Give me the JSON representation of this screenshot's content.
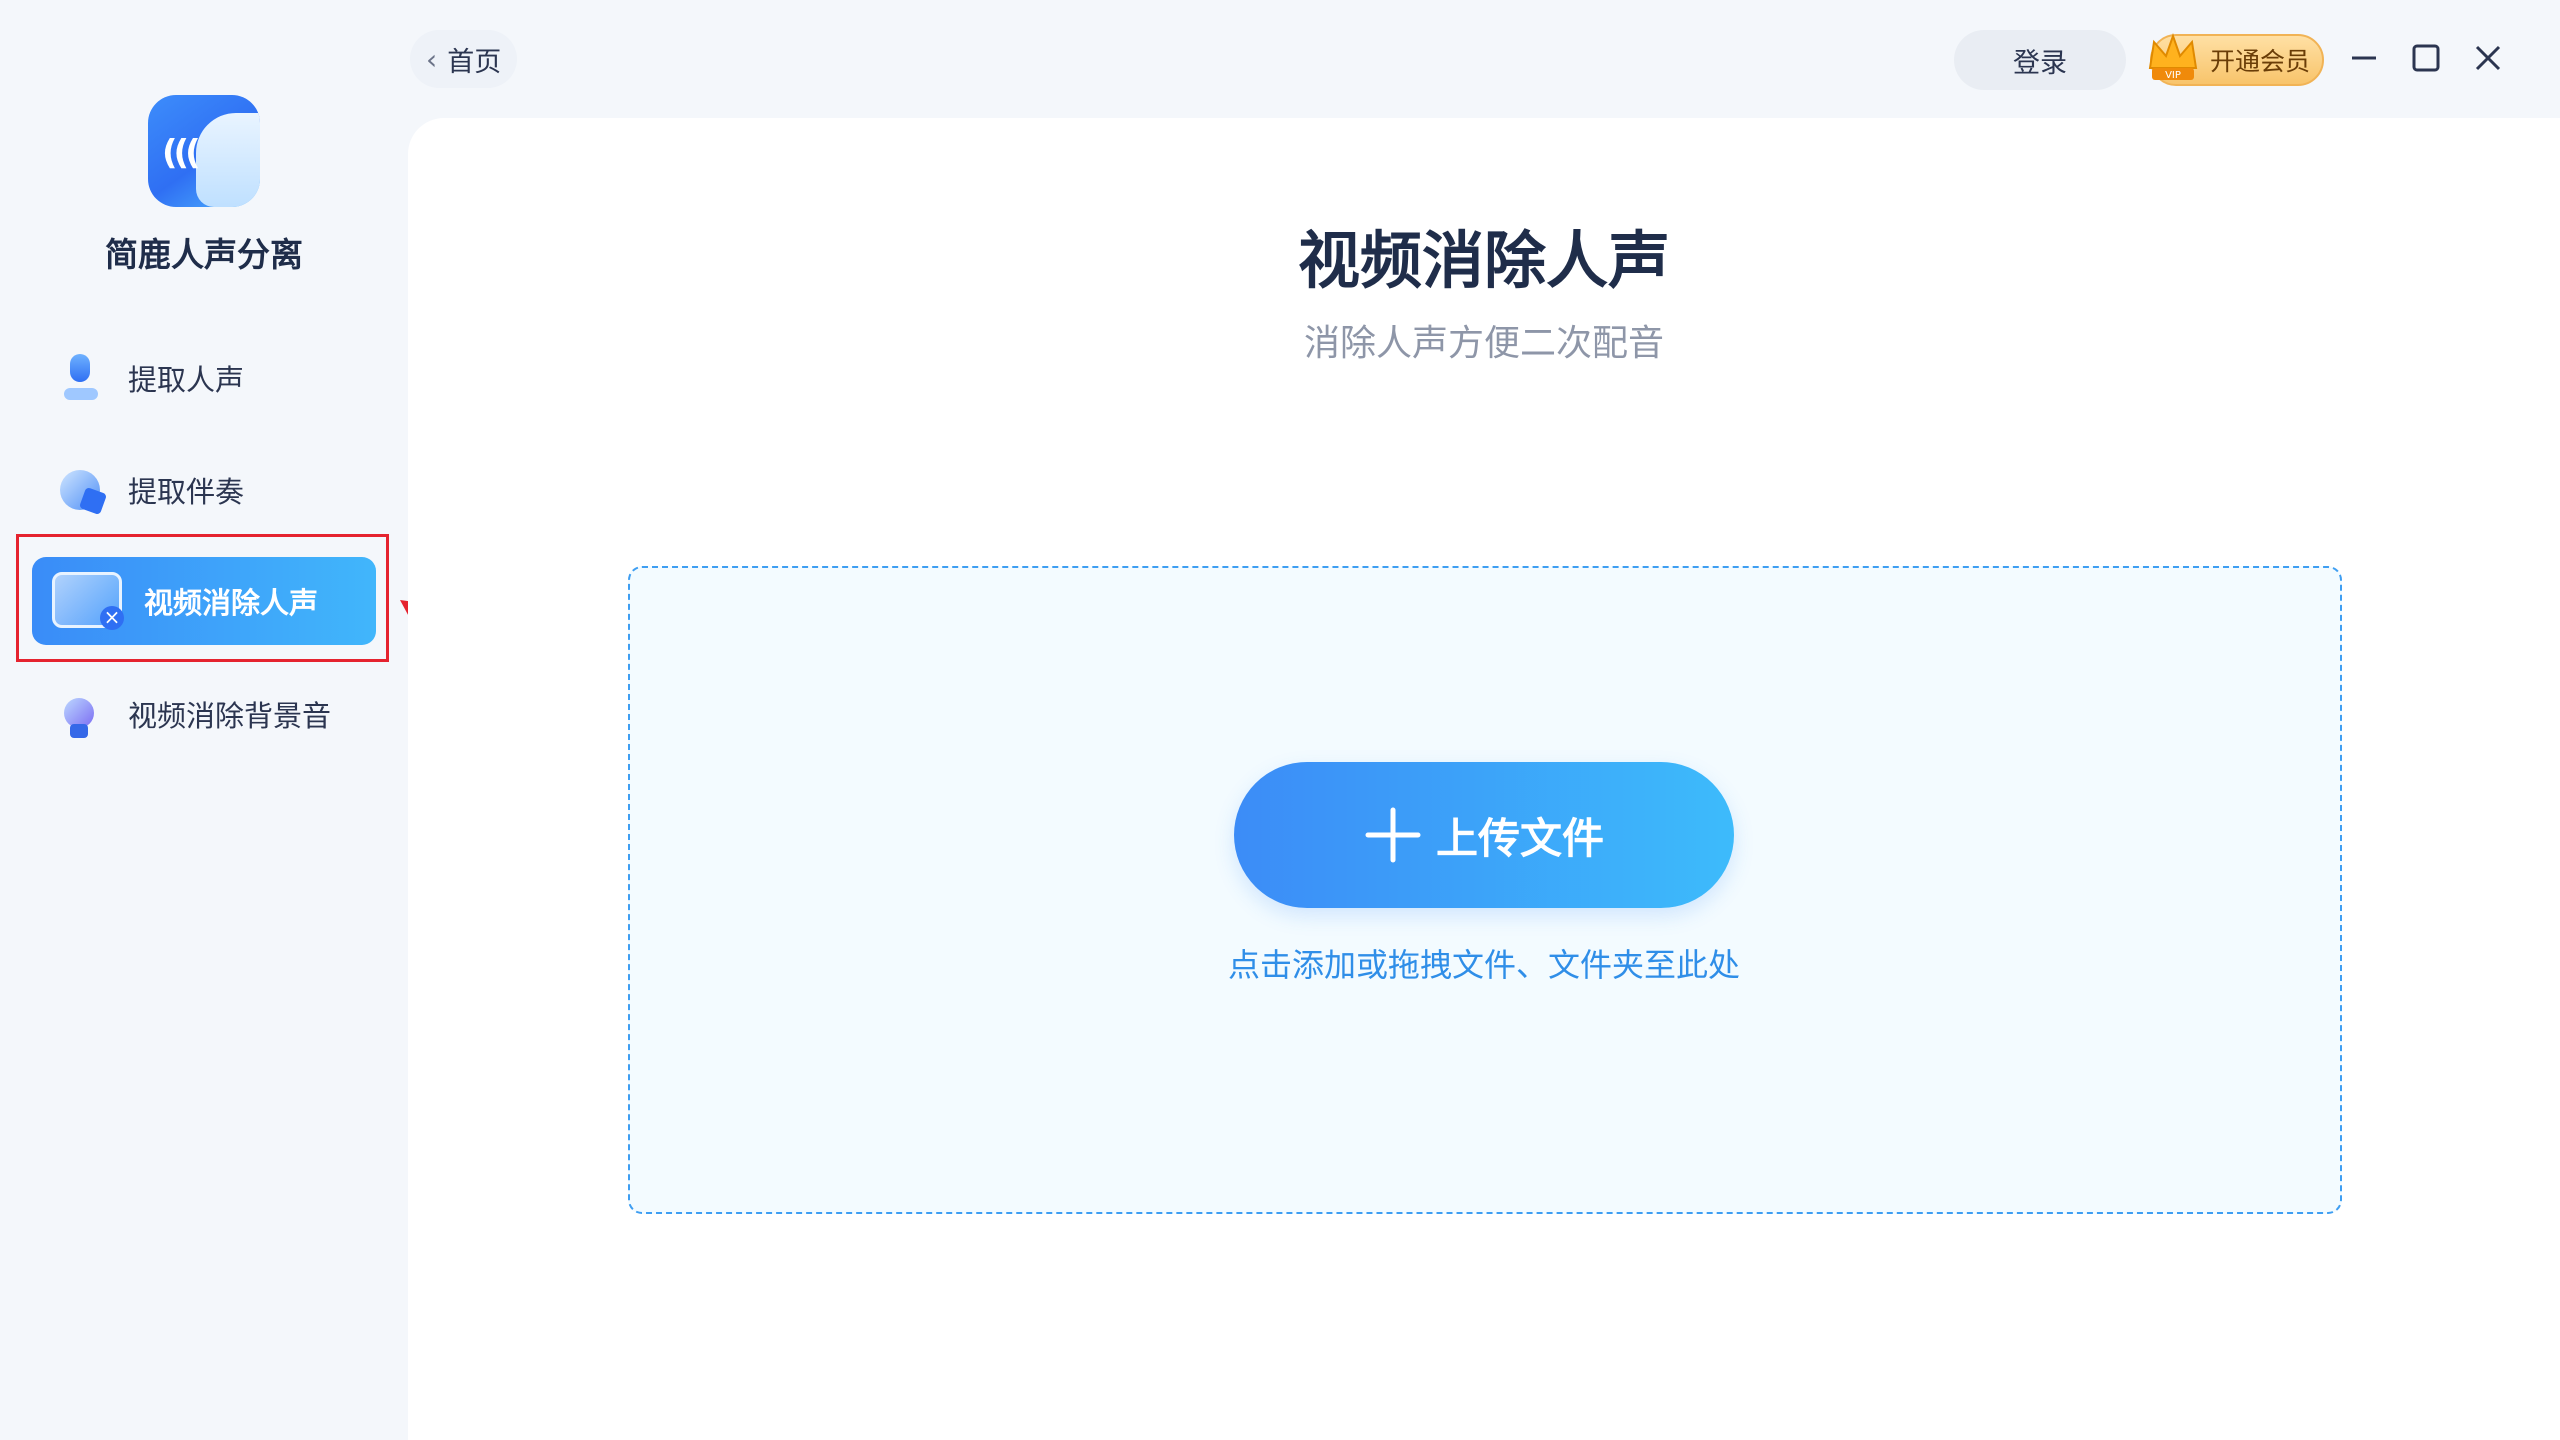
{
  "app": {
    "name": "简鹿人声分离"
  },
  "topbar": {
    "back_label": "首页",
    "login_label": "登录",
    "vip_label": "开通会员",
    "vip_badge": "VIP"
  },
  "sidebar": {
    "items": [
      {
        "label": "提取人声",
        "icon": "microphone-icon",
        "active": false
      },
      {
        "label": "提取伴奏",
        "icon": "music-disc-icon",
        "active": false
      },
      {
        "label": "视频消除人声",
        "icon": "video-mute-icon",
        "active": true
      },
      {
        "label": "视频消除背景音",
        "icon": "speaker-icon",
        "active": false
      }
    ]
  },
  "main": {
    "title": "视频消除人声",
    "subtitle": "消除人声方便二次配音",
    "upload_label": "上传文件",
    "drop_hint": "点击添加或拖拽文件、文件夹至此处"
  },
  "colors": {
    "accent": "#3a8cf8",
    "accent_light": "#41b6fb",
    "highlight": "#e5232f",
    "vip_gold": "#f8c46b"
  }
}
